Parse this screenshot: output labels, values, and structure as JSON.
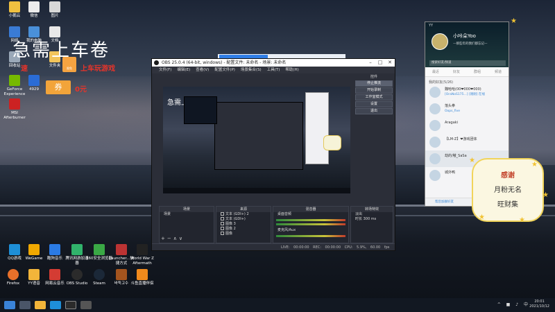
{
  "desktop": {
    "icons": [
      {
        "label": "小鹅云",
        "color": "#f0c040"
      },
      {
        "label": "微信",
        "color": "#ececec"
      },
      {
        "label": "图片",
        "color": "#d8d8d8"
      },
      {
        "label": "网络",
        "color": "#3a7bd5"
      },
      {
        "label": "我的电脑",
        "color": "#4a90d9"
      },
      {
        "label": "文档",
        "color": "#e8e8e8"
      },
      {
        "label": "回收站",
        "color": "#9aa8b8"
      },
      {
        "label": "文件夹",
        "color": "#f2c45a"
      },
      {
        "label": "GeForce Experience",
        "color": "#76b900"
      },
      {
        "label": "4929",
        "color": "#2a6cd6"
      },
      {
        "label": "MSI Afterburner",
        "color": "#c22"
      }
    ],
    "bottom_icons": [
      {
        "label": "QQ游戏",
        "color": "#1e8fd8"
      },
      {
        "label": "WeGame",
        "color": "#f0a800"
      },
      {
        "label": "酷狗音乐",
        "color": "#2b7be4"
      },
      {
        "label": "腾讯网游加速器",
        "color": "#31b36b"
      },
      {
        "label": "360安全浏览器",
        "color": "#3aa845"
      },
      {
        "label": "Launcher...快捷方式",
        "color": "#b33"
      },
      {
        "label": "World War Z Aftermath",
        "color": "#222"
      },
      {
        "label": "Firefox",
        "color": "#e8702a"
      },
      {
        "label": "YY语音",
        "color": "#f2b53a"
      },
      {
        "label": "网易云音乐",
        "color": "#d43c33"
      },
      {
        "label": "OBS Studio",
        "color": "#2b2b2b"
      },
      {
        "label": "Steam",
        "color": "#1b2838"
      },
      {
        "label": "바둑고수",
        "color": "#a3541e"
      },
      {
        "label": "斗鱼直播伴侣",
        "color": "#f08a1c"
      }
    ]
  },
  "promo": {
    "title": "急需上车卷",
    "red_left": "速",
    "red_right": "上车玩游戏",
    "coupon": "券",
    "coupon_tail": "0元",
    "badge": "限免"
  },
  "obs": {
    "title": "OBS 25.0.4 (64-bit, windows) - 配置文件: 未命名 - 场景: 未命名",
    "menu": [
      "文件(F)",
      "编辑(E)",
      "查看(V)",
      "配置文件(P)",
      "场景集合(S)",
      "工具(T)",
      "帮助(H)"
    ],
    "preview_text": "急需上车卷",
    "controls_header": "控件",
    "controls": [
      "停止推流",
      "开始录制",
      "工作室模式",
      "设置",
      "退出"
    ],
    "docks": [
      {
        "title": "场景",
        "items": [
          "场景"
        ]
      },
      {
        "title": "来源",
        "items": [
          "文本 (GDI+) 2",
          "文本 (GDI+)",
          "图像 3",
          "图像 2",
          "图像"
        ]
      },
      {
        "title": "混音器",
        "items": [
          "桌面音频",
          "麦克风/Aux"
        ]
      },
      {
        "title": "转场特效",
        "items": [
          "淡出",
          "时长 300 ms"
        ]
      }
    ],
    "status": "LIVE: 00:00:00   REC: 00:00:00   CPU: 5.9%, 60.00 fps"
  },
  "yy": {
    "brand": "YY",
    "nickname": "小咔朵Yoo",
    "signature": "—那些年的我们都忘记—",
    "search_placeholder": "搜索好友/频道",
    "tabs": [
      "最近",
      "好友",
      "群组",
      "频道"
    ],
    "group": "我的好友(5/26)",
    "contacts": [
      {
        "name": "魏哈哈(00❤000❤000)",
        "sub": "[OraNoS175...] [刚刚] 在线"
      },
      {
        "name": "落头拳",
        "sub": "Oops_five"
      },
      {
        "name": "Aragaki",
        "sub": ""
      },
      {
        "name": "【LM-Z】❤游戏团体",
        "sub": ""
      },
      {
        "name": "劫的/嗷_SaSa",
        "sub": ""
      },
      {
        "name": "城外鸭",
        "sub": ""
      }
    ],
    "bottom": "帮您加群好友"
  },
  "sticker": {
    "line1": "感谢",
    "line2": "月粉无名",
    "line3": "旺财集"
  },
  "taskbar": {
    "items": [
      "start",
      "cortana",
      "yy",
      "qq",
      "obs",
      "obs-studio"
    ],
    "tray": "^ ■ ♪ 中",
    "time": "20:01",
    "date": "2021/10/12"
  }
}
